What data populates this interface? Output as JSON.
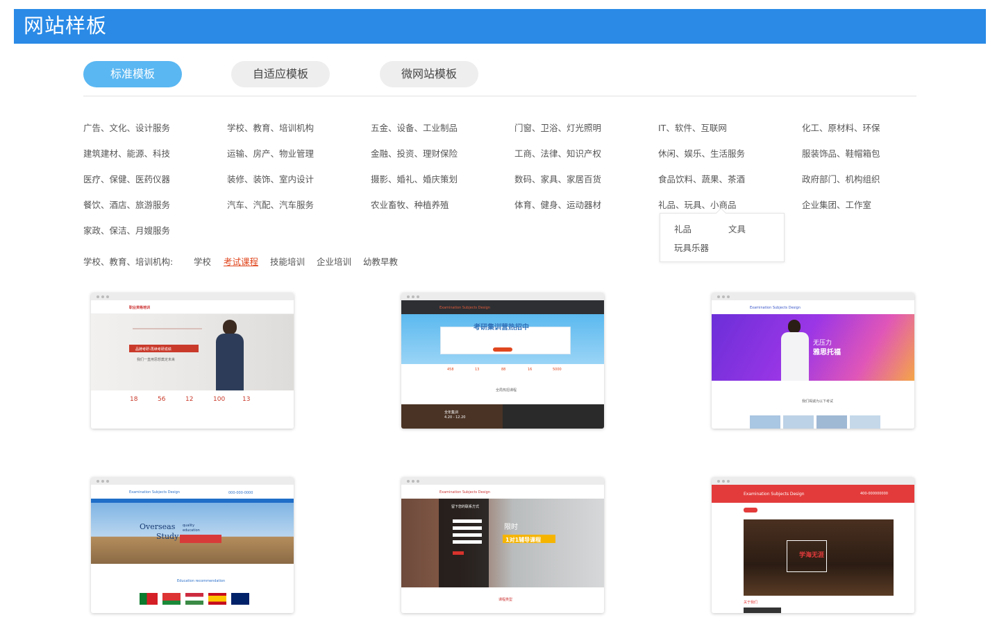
{
  "header": {
    "title": "网站样板"
  },
  "tabs": [
    {
      "label": "标准模板",
      "active": true
    },
    {
      "label": "自适应模板",
      "active": false
    },
    {
      "label": "微网站模板",
      "active": false
    }
  ],
  "categories": [
    [
      "广告、文化、设计服务",
      "学校、教育、培训机构",
      "五金、设备、工业制品",
      "门窗、卫浴、灯光照明",
      "IT、软件、互联网",
      "化工、原材料、环保"
    ],
    [
      "建筑建材、能源、科技",
      "运输、房产、物业管理",
      "金融、投资、理财保险",
      "工商、法律、知识产权",
      "休闲、娱乐、生活服务",
      "服装饰品、鞋帽箱包"
    ],
    [
      "医疗、保健、医药仪器",
      "装修、装饰、室内设计",
      "摄影、婚礼、婚庆策划",
      "数码、家具、家居百货",
      "食品饮料、蔬果、茶酒",
      "政府部门、机构组织"
    ],
    [
      "餐饮、酒店、旅游服务",
      "汽车、汽配、汽车服务",
      "农业畜牧、种植养殖",
      "体育、健身、运动器材",
      "礼品、玩具、小商品",
      "企业集团、工作室"
    ],
    [
      "家政、保洁、月嫂服务"
    ]
  ],
  "dropdown": {
    "items": [
      "礼品",
      "文具",
      "玩具乐器"
    ]
  },
  "subnav": {
    "label": "学校、教育、培训机构:",
    "items": [
      {
        "label": "学校",
        "active": false
      },
      {
        "label": "考试课程",
        "active": true
      },
      {
        "label": "技能培训",
        "active": false
      },
      {
        "label": "企业培训",
        "active": false
      },
      {
        "label": "幼教早教",
        "active": false
      }
    ]
  },
  "templates": {
    "t1": {
      "logo": "职业资格培训",
      "slogan": "品牌考研-再续考研成绩",
      "sub": "我们一直用思想奠定未来",
      "stats": [
        "18",
        "56",
        "12",
        "100",
        "13"
      ]
    },
    "t2": {
      "logo": "Examination Subjects Design",
      "headline": "考研集训营热招中",
      "stats": [
        "458",
        "13",
        "88",
        "16",
        "5000"
      ],
      "section": "全局热招课程",
      "card1": "全年集训",
      "card1_date": "4.20 - 12.20"
    },
    "t3": {
      "logo": "Examination Subjects Design",
      "headline1": "无压力",
      "headline2": "雅思托福",
      "section": "我们竭诚为以下考试"
    },
    "t4": {
      "logo": "Examination Subjects Design",
      "phone": "000-000-0000",
      "title1": "Overseas",
      "title2": "Study",
      "tag1": "quality",
      "tag2": "education",
      "section": "Education recommendation"
    },
    "t5": {
      "logo": "Examination Subjects Design",
      "form_title": "留下您的联系方式",
      "headline1": "限时",
      "headline2": "1对1辅导课程",
      "section": "课程类型"
    },
    "t6": {
      "logo": "Examination Subjects Design",
      "phone": "400-000000000",
      "headline": "学海无涯",
      "section": "关于我们"
    }
  },
  "colors": {
    "header": "#2a8ae6",
    "tab_active": "#5ab7f2",
    "sub_active": "#e0471f"
  }
}
